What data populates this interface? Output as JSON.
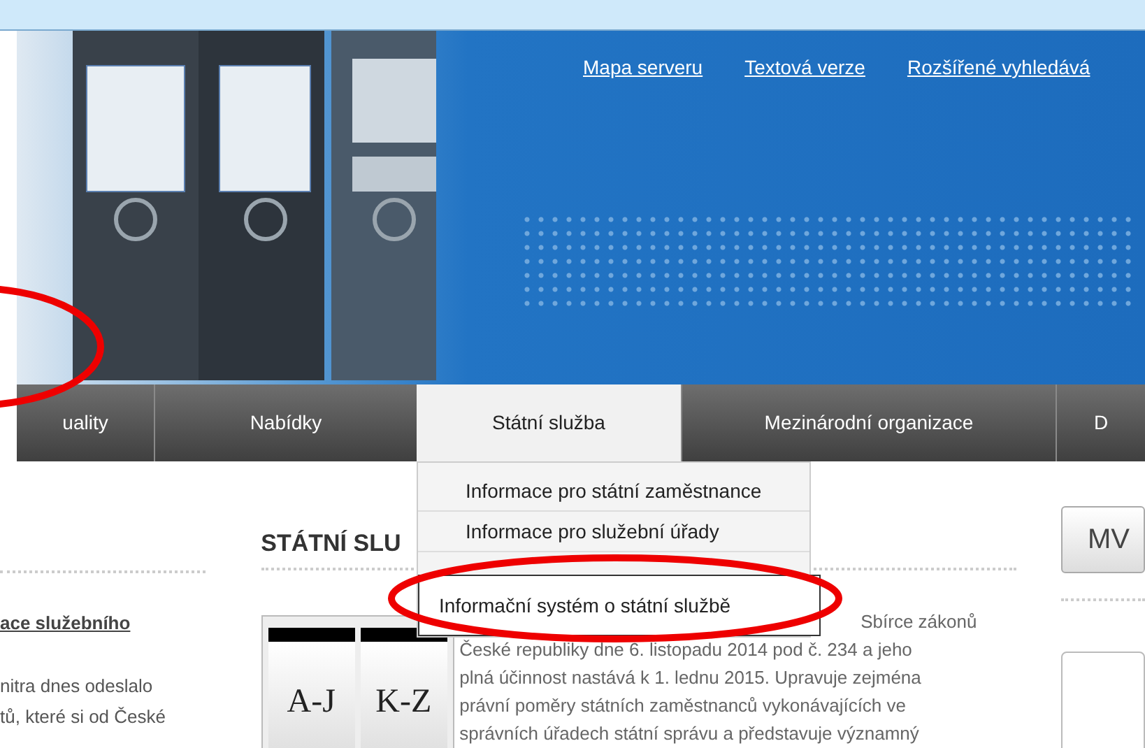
{
  "header_links": [
    {
      "label": "Mapa serveru"
    },
    {
      "label": "Textová verze"
    },
    {
      "label": "Rozšířené vyhledává"
    }
  ],
  "nav": [
    {
      "label": "uality",
      "selected": false
    },
    {
      "label": "Nabídky",
      "selected": false
    },
    {
      "label": "Státní služba",
      "selected": true
    },
    {
      "label": "Mezinárodní organizace",
      "selected": false
    },
    {
      "label": "D",
      "selected": false
    }
  ],
  "dropdown": [
    {
      "label": "Informace pro státní zaměstnance",
      "selected": false
    },
    {
      "label": "Informace pro služební úřady",
      "selected": false
    },
    {
      "label": "Informační systém o státní službě",
      "selected": true
    }
  ],
  "left_column": {
    "link": "ace služebního",
    "lines": [
      "nitra dnes odeslalo",
      "tů, které si od České"
    ]
  },
  "main": {
    "heading": "STÁTNÍ SLU",
    "image_labels": [
      "A-J",
      "K-Z"
    ],
    "lines": [
      "Sbírce zákonů",
      "České republiky dne 6. listopadu 2014 pod č. 234 a jeho",
      "plná účinnost nastává k 1. lednu 2015. Upravuje zejména",
      "právní poměry státních zaměstnanců vykonávajících ve",
      "správních úřadech státní správu a představuje významný"
    ]
  },
  "right_column": {
    "button": "MV"
  }
}
